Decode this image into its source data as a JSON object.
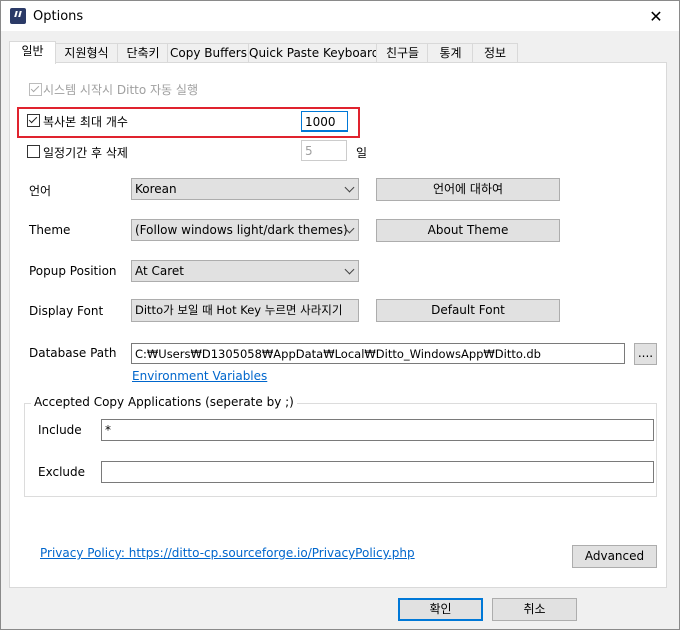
{
  "window": {
    "title": "Options",
    "close_glyph": "✕"
  },
  "tabs": [
    "일반",
    "지원형식",
    "단축키",
    "Copy Buffers",
    "Quick Paste Keyboard",
    "친구들",
    "통계",
    "정보"
  ],
  "general": {
    "autostart_label": "시스템 시작시 Ditto 자동 실행",
    "max_copies_label": "복사본 최대 개수",
    "max_copies_value": "1000",
    "expire_label": "일정기간 후 삭제",
    "expire_value": "5",
    "expire_unit": "일",
    "language_label": "언어",
    "language_value": "Korean",
    "about_language_button": "언어에 대하여",
    "theme_label": "Theme",
    "theme_value": "(Follow windows light/dark themes)",
    "about_theme_button": "About Theme",
    "popup_position_label": "Popup Position",
    "popup_position_value": "At Caret",
    "display_font_label": "Display Font",
    "display_font_value": "Ditto가 보일 때 Hot Key 누르면 사라지기",
    "default_font_button": "Default Font",
    "db_path_label": "Database Path",
    "db_path_value": "C:₩Users₩D1305058₩AppData₩Local₩Ditto_WindowsApp₩Ditto.db",
    "browse_button": "....",
    "env_vars_link": "Environment Variables",
    "accepted_group_label": "Accepted Copy Applications (seperate by ;)",
    "include_label": "Include",
    "include_value": "*",
    "exclude_label": "Exclude",
    "exclude_value": "",
    "privacy_link": "Privacy Policy: https://ditto-cp.sourceforge.io/PrivacyPolicy.php",
    "advanced_button": "Advanced"
  },
  "footer": {
    "ok_button": "확인",
    "cancel_button": "취소"
  },
  "colors": {
    "highlight": "#e0232e",
    "link": "#0066cc",
    "focus": "#0078d7"
  }
}
